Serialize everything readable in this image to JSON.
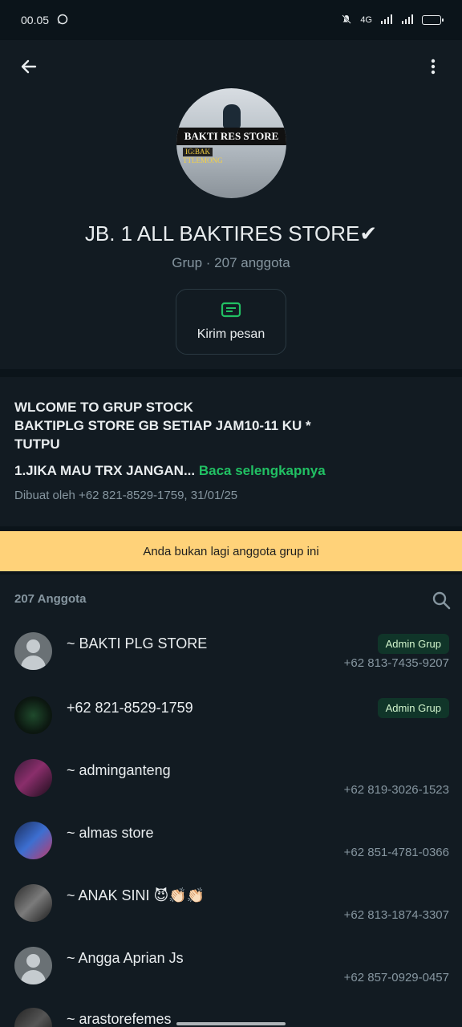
{
  "status_bar": {
    "time": "00.05",
    "network": "4G",
    "network_b": "4G"
  },
  "group": {
    "title": "JB. 1 ALL BAKTIRES STORE✔",
    "subtitle": "Grup · 207 anggota",
    "avatar_banner": "BAKTI RES STORE",
    "avatar_ig": "IG:BAK",
    "avatar_tiktok": "TTLEMONG"
  },
  "actions": {
    "send_label": "Kirim pesan"
  },
  "description": {
    "text": "WLCOME TO GRUP STOCK\nBAKTIPLG STORE GB SETIAP JAM10-11 KU *\nTUTPU",
    "rule": "1.JIKA MAU TRX JANGAN...",
    "read_more": "Baca selengkapnya",
    "meta": "Dibuat oleh +62 821-8529-1759, 31/01/25"
  },
  "notice": "Anda bukan lagi anggota grup ini",
  "members": {
    "count_label": "207 Anggota",
    "items": [
      {
        "name": "~ BAKTI PLG STORE",
        "phone": "+62 813-7435-9207",
        "badge": "Admin Grup",
        "avatar": "default"
      },
      {
        "name": "+62 821-8529-1759",
        "phone": "",
        "badge": "Admin Grup",
        "avatar": "dark-green"
      },
      {
        "name": "~ adminganteng",
        "phone": "+62 819-3026-1523",
        "badge": "",
        "avatar": "purple"
      },
      {
        "name": "~ almas store",
        "phone": "+62 851-4781-0366",
        "badge": "",
        "avatar": "blue"
      },
      {
        "name": "~ ANAK SINI 😈👏🏻👏🏻",
        "phone": "+62 813-1874-3307",
        "badge": "",
        "avatar": "gray-photo"
      },
      {
        "name": "~ Angga Aprian Js",
        "phone": "+62 857-0929-0457",
        "badge": "",
        "avatar": "default"
      },
      {
        "name": "~ arastorefemes",
        "phone": "",
        "badge": "",
        "avatar": "dark-photo"
      }
    ]
  },
  "colors": {
    "accent": "#21c063",
    "notice_bg": "#ffd279",
    "badge_bg": "#103529"
  }
}
